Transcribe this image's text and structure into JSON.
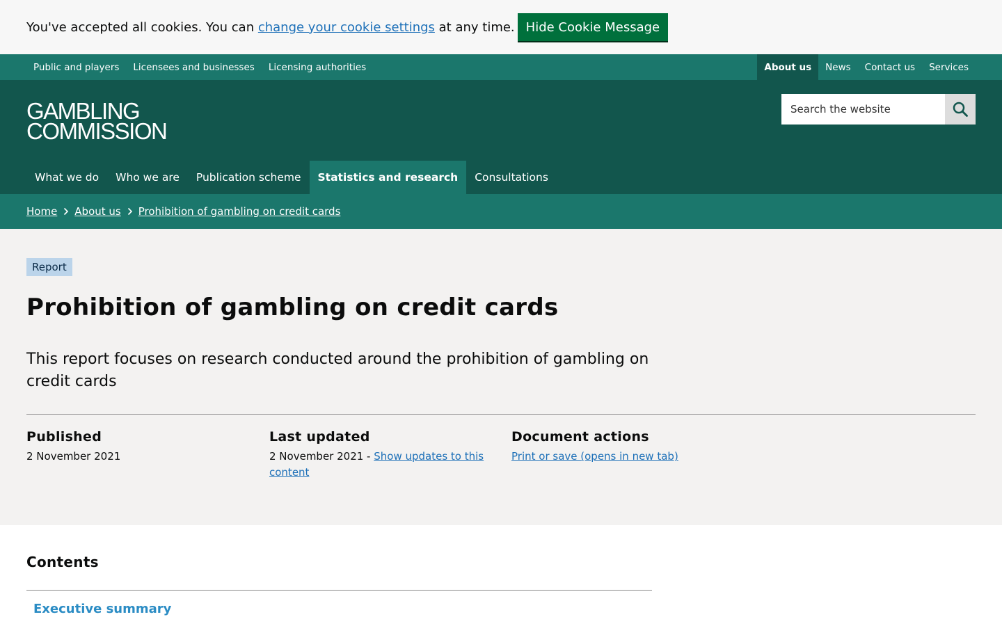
{
  "cookie": {
    "text_before": "You've accepted all cookies. You can ",
    "link": "change your cookie settings",
    "text_after": " at any time.",
    "button": "Hide Cookie Message"
  },
  "util_nav": {
    "left": [
      "Public and players",
      "Licensees and businesses",
      "Licensing authorities"
    ],
    "right": [
      "About us",
      "News",
      "Contact us",
      "Services"
    ],
    "active": "About us"
  },
  "header": {
    "logo_line1": "GAMBLING",
    "logo_line2": "COMMISSION",
    "search_placeholder": "Search the website"
  },
  "main_nav": {
    "items": [
      "What we do",
      "Who we are",
      "Publication scheme",
      "Statistics and research",
      "Consultations"
    ],
    "active": "Statistics and research"
  },
  "breadcrumb": [
    "Home",
    "About us",
    "Prohibition of gambling on credit cards"
  ],
  "page": {
    "tag": "Report",
    "title": "Prohibition of gambling on credit cards",
    "lede": "This report focuses on research conducted around the prohibition of gambling on credit cards"
  },
  "meta": {
    "published_label": "Published",
    "published_value": "2 November 2021",
    "updated_label": "Last updated",
    "updated_value": "2 November 2021 - ",
    "updated_link": "Show updates to this content",
    "actions_label": "Document actions",
    "actions_link": "Print or save (opens in new tab)"
  },
  "contents": {
    "heading": "Contents",
    "items": [
      "Executive summary"
    ]
  },
  "colors": {
    "cookie_bg": "#f7f7f7",
    "cookie_button": "#00703c",
    "util_nav_bg": "#1b776c",
    "header_bg": "#12564d",
    "breadcrumb_bg": "#1b776c",
    "hero_bg": "#f3f2f1",
    "tag_bg": "#bbd4ea",
    "link": "#1d70b8"
  },
  "icons": {
    "search": "search-icon",
    "breadcrumb_separator": "chevron-right-icon"
  }
}
